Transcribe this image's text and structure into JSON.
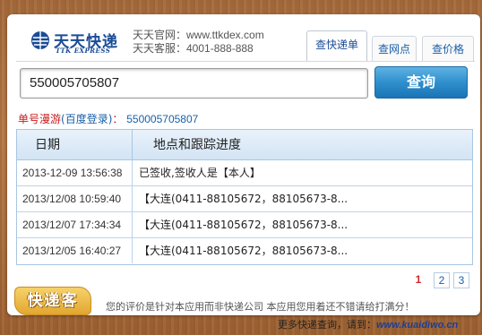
{
  "header": {
    "logo_cn": "天天快递",
    "logo_en": "TTK EXPRESS",
    "site_label": "天天官网：www.ttkdex.com",
    "service_label": "天天客服：4001-888-888"
  },
  "tabs": [
    {
      "label": "查快递单",
      "active": true
    },
    {
      "label": "查网点",
      "active": false
    },
    {
      "label": "查价格",
      "active": false
    }
  ],
  "search": {
    "value": "550005705807",
    "button_label": "查询"
  },
  "tracking": {
    "prefix": "单号漫游",
    "link": "(百度登录)",
    "colon": "：",
    "number": "550005705807"
  },
  "table": {
    "headers": {
      "date": "日期",
      "location": "地点和跟踪进度"
    },
    "rows": [
      {
        "date": "2013-12-09 13:56:38",
        "location": "已签收,签收人是【本人】"
      },
      {
        "date": "2013/12/08 10:59:40",
        "location": "【大连(0411-88105672，88105673-8..."
      },
      {
        "date": "2013/12/07 17:34:34",
        "location": "【大连(0411-88105672，88105673-8..."
      },
      {
        "date": "2013/12/05 16:40:27",
        "location": "【大连(0411-88105672，88105673-8..."
      }
    ]
  },
  "pagination": {
    "current": "1",
    "pages": [
      "2",
      "3"
    ]
  },
  "footer": {
    "badge": "快递客",
    "notice": "您的评价是针对本应用而非快递公司 本应用您用着还不错请给打满分！",
    "more_prefix": "更多快递查询，请到：",
    "more_url": "www.kuaidiwo.cn"
  },
  "colors": {
    "accent": "#1a5fa8",
    "brand": "#1a4b96",
    "alert": "#c81c1c",
    "button": "#2f8fcd",
    "background": "#a5693a"
  }
}
